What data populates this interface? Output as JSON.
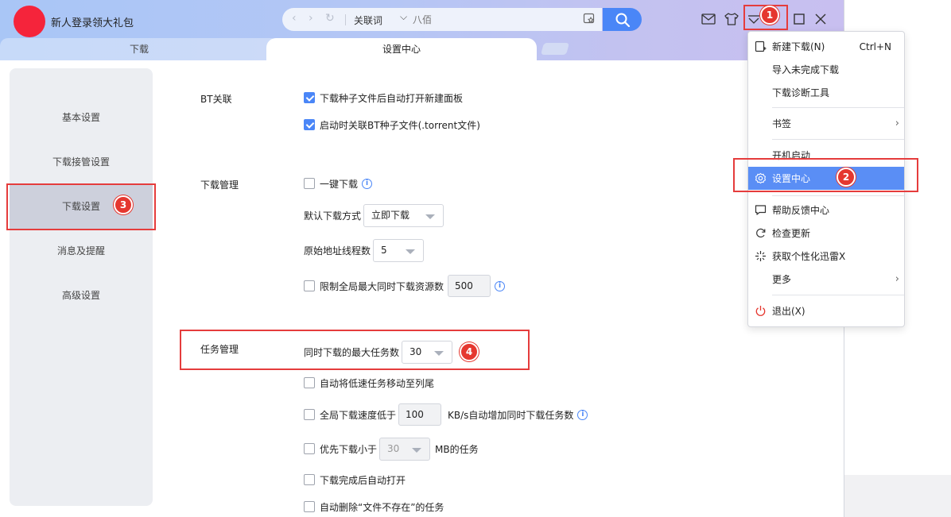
{
  "titlebar": {
    "promo_text": "新人登录领大礼包",
    "search": {
      "keyword_label": "关联词",
      "placeholder": "八佰"
    }
  },
  "tabs": [
    {
      "label": "下载"
    },
    {
      "label": "设置中心"
    }
  ],
  "sidebar": {
    "items": [
      {
        "label": "基本设置"
      },
      {
        "label": "下载接管设置"
      },
      {
        "label": "下载设置",
        "active": true
      },
      {
        "label": "消息及提醒"
      },
      {
        "label": "高级设置"
      }
    ]
  },
  "sections": {
    "bt": {
      "title": "BT关联",
      "options": [
        {
          "label": "下载种子文件后自动打开新建面板",
          "checked": true
        },
        {
          "label": "启动时关联BT种子文件(.torrent文件)",
          "checked": true
        }
      ]
    },
    "download": {
      "title": "下载管理",
      "one_click": {
        "label": "一键下载",
        "checked": false
      },
      "default_mode": {
        "label": "默认下载方式",
        "value": "立即下载"
      },
      "threads": {
        "label": "原始地址线程数",
        "value": "5"
      },
      "limit_sources": {
        "label": "限制全局最大同时下载资源数",
        "value": "500",
        "checked": false
      }
    },
    "task": {
      "title": "任务管理",
      "max_tasks": {
        "label": "同时下载的最大任务数",
        "value": "30"
      },
      "move_slow": {
        "label": "自动将低速任务移动至列尾",
        "checked": false
      },
      "speed_below": {
        "label_prefix": "全局下载速度低于",
        "value": "100",
        "label_suffix": "KB/s自动增加同时下载任务数",
        "checked": false
      },
      "priority_small": {
        "label_prefix": "优先下载小于",
        "value": "30",
        "label_suffix": "MB的任务",
        "checked": false
      },
      "auto_open": {
        "label": "下载完成后自动打开",
        "checked": false
      },
      "auto_delete": {
        "label": "自动删除“文件不存在”的任务",
        "checked": false
      }
    }
  },
  "menu": {
    "items": [
      {
        "label": "新建下载(N)",
        "shortcut": "Ctrl+N",
        "icon": "new-download-icon"
      },
      {
        "label": "导入未完成下载"
      },
      {
        "label": "下载诊断工具"
      },
      {
        "label": "书签",
        "has_submenu": true
      },
      {
        "label": "开机启动"
      },
      {
        "label": "设置中心",
        "icon": "gear-icon",
        "selected": true
      },
      {
        "label": "帮助反馈中心",
        "icon": "feedback-icon"
      },
      {
        "label": "检查更新",
        "icon": "refresh-icon"
      },
      {
        "label": "获取个性化迅雷X",
        "icon": "sparkle-icon"
      },
      {
        "label": "更多",
        "has_submenu": true
      },
      {
        "label": "退出(X)",
        "icon": "power-icon"
      }
    ]
  },
  "annotations": [
    "1",
    "2",
    "3",
    "4"
  ],
  "colors": {
    "accent": "#4a86f7",
    "annotation": "#e5372f",
    "menu_highlight": "#5a8ef5"
  }
}
